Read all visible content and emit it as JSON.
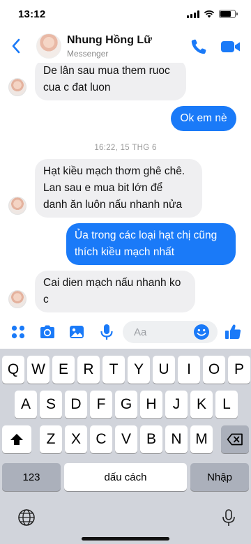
{
  "status_bar": {
    "time": "13:12",
    "battery_level": 0.8
  },
  "header": {
    "contact_name": "Nhung Hồng Lữ",
    "subtitle": "Messenger",
    "icons": [
      "back-chevron",
      "phone",
      "video-camera"
    ],
    "accent_color": "#1a7af8"
  },
  "messages": [
    {
      "direction": "in",
      "text_lines": [
        "De lân sau mua them ruoc",
        "cua c đat luon"
      ],
      "show_avatar": true
    },
    {
      "direction": "out",
      "text_lines": [
        "Ok em nè"
      ]
    },
    {
      "type": "timestamp",
      "text": "16:22, 15 THG 6"
    },
    {
      "direction": "in",
      "text_lines": [
        "Hạt kiều mạch thơm ghê chê.",
        "Lan sau e mua bit lớn để",
        "danh ăn luôn nấu nhanh nửa"
      ],
      "show_avatar": true
    },
    {
      "direction": "out",
      "text_lines": [
        "Ủa trong các loại hạt chị cũng",
        "thích kiều mạch nhất"
      ]
    },
    {
      "direction": "in",
      "text_lines": [
        "Cai dien mạch nấu nhanh ko",
        "c"
      ],
      "show_avatar": true
    }
  ],
  "composer": {
    "placeholder": "Aa",
    "icons": [
      "apps-grid",
      "camera",
      "photo",
      "microphone",
      "emoji",
      "thumbs-up"
    ]
  },
  "keyboard": {
    "row1": [
      "Q",
      "W",
      "E",
      "R",
      "T",
      "Y",
      "U",
      "I",
      "O",
      "P"
    ],
    "row2": [
      "A",
      "S",
      "D",
      "F",
      "G",
      "H",
      "J",
      "K",
      "L"
    ],
    "row3": [
      "Z",
      "X",
      "C",
      "V",
      "B",
      "N",
      "M"
    ],
    "numbers_key": "123",
    "space_key": "dấu cách",
    "return_key": "Nhập",
    "icons": [
      "shift-arrow",
      "backspace",
      "globe",
      "dictation-mic"
    ]
  }
}
